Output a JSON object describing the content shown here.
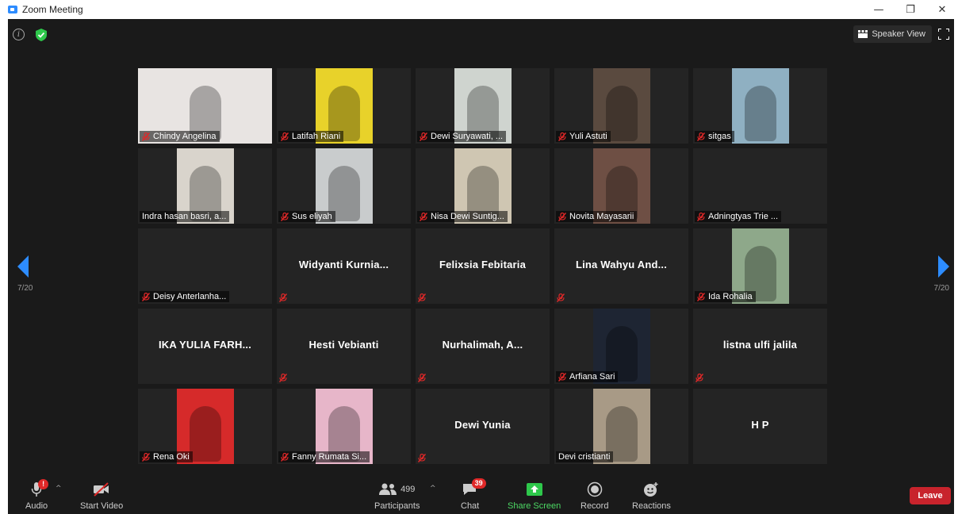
{
  "window": {
    "title": "Zoom Meeting",
    "minimize": "—",
    "maximize": "❐",
    "close": "✕"
  },
  "header": {
    "speaker_view_label": "Speaker View"
  },
  "pagination": {
    "left": "7/20",
    "right": "7/20"
  },
  "colors": {
    "accent": "#2d8cff",
    "share_green": "#4cd964",
    "leave_red": "#c8232c",
    "mute_red": "#e02828"
  },
  "tiles": [
    {
      "name": "Chindy Angelina",
      "video": true,
      "muted": true,
      "bg": "#e8e4e2"
    },
    {
      "name": "Latifah Riani",
      "video": true,
      "muted": true,
      "bg": "#e8d22a"
    },
    {
      "name": "Dewi Suryawati, ...",
      "video": true,
      "muted": true,
      "bg": "#cfd4cf"
    },
    {
      "name": "Yuli Astuti",
      "video": true,
      "muted": true,
      "bg": "#5a4a3f"
    },
    {
      "name": "sitgas",
      "video": true,
      "muted": true,
      "bg": "#8fb0c2"
    },
    {
      "name": "Indra hasan basri, a...",
      "video": true,
      "muted": false,
      "bg": "#d9d4cc"
    },
    {
      "name": "Sus eliyah",
      "video": true,
      "muted": true,
      "bg": "#c9cccd"
    },
    {
      "name": "Nisa Dewi Suntig...",
      "video": true,
      "muted": true,
      "bg": "#cfc6b2"
    },
    {
      "name": "Novita Mayasarii",
      "video": true,
      "muted": true,
      "bg": "#6e4f44"
    },
    {
      "name": "Adningtyas Trie ...",
      "video": false,
      "muted": true,
      "display": ""
    },
    {
      "name": "Deisy Anterlanha...",
      "video": false,
      "muted": true,
      "display": ""
    },
    {
      "name": "",
      "video": false,
      "muted": true,
      "display": "Widyanti  Kurnia..."
    },
    {
      "name": "",
      "video": false,
      "muted": true,
      "display": "Felixsia Febitaria"
    },
    {
      "name": "",
      "video": false,
      "muted": true,
      "display": "Lina  Wahyu  And..."
    },
    {
      "name": "Ida Rohalia",
      "video": true,
      "muted": true,
      "bg": "#8ea88a"
    },
    {
      "name": "",
      "video": false,
      "muted": false,
      "display": "IKA YULIA FARH..."
    },
    {
      "name": "",
      "video": false,
      "muted": true,
      "display": "Hesti Vebianti"
    },
    {
      "name": "",
      "video": false,
      "muted": true,
      "display": "Nurhalimah,  A..."
    },
    {
      "name": "Arfiana Sari",
      "video": true,
      "muted": true,
      "bg": "#1e2533"
    },
    {
      "name": "",
      "video": false,
      "muted": true,
      "display": "listna ulfi jalila"
    },
    {
      "name": "Rena Oki",
      "video": true,
      "muted": true,
      "bg": "#d62a2a"
    },
    {
      "name": "Fanny Rumata Si...",
      "video": true,
      "muted": true,
      "bg": "#e7b6c9"
    },
    {
      "name": "",
      "video": false,
      "muted": true,
      "display": "Dewi Yunia"
    },
    {
      "name": "Devi cristianti",
      "video": true,
      "muted": false,
      "bg": "#a89a86"
    },
    {
      "name": "",
      "video": false,
      "muted": false,
      "display": "H P"
    }
  ],
  "toolbar": {
    "audio_label": "Audio",
    "audio_badge": "!",
    "video_label": "Start Video",
    "participants_label": "Participants",
    "participants_count": "499",
    "chat_label": "Chat",
    "chat_badge": "39",
    "share_label": "Share Screen",
    "record_label": "Record",
    "reactions_label": "Reactions",
    "leave_label": "Leave"
  }
}
